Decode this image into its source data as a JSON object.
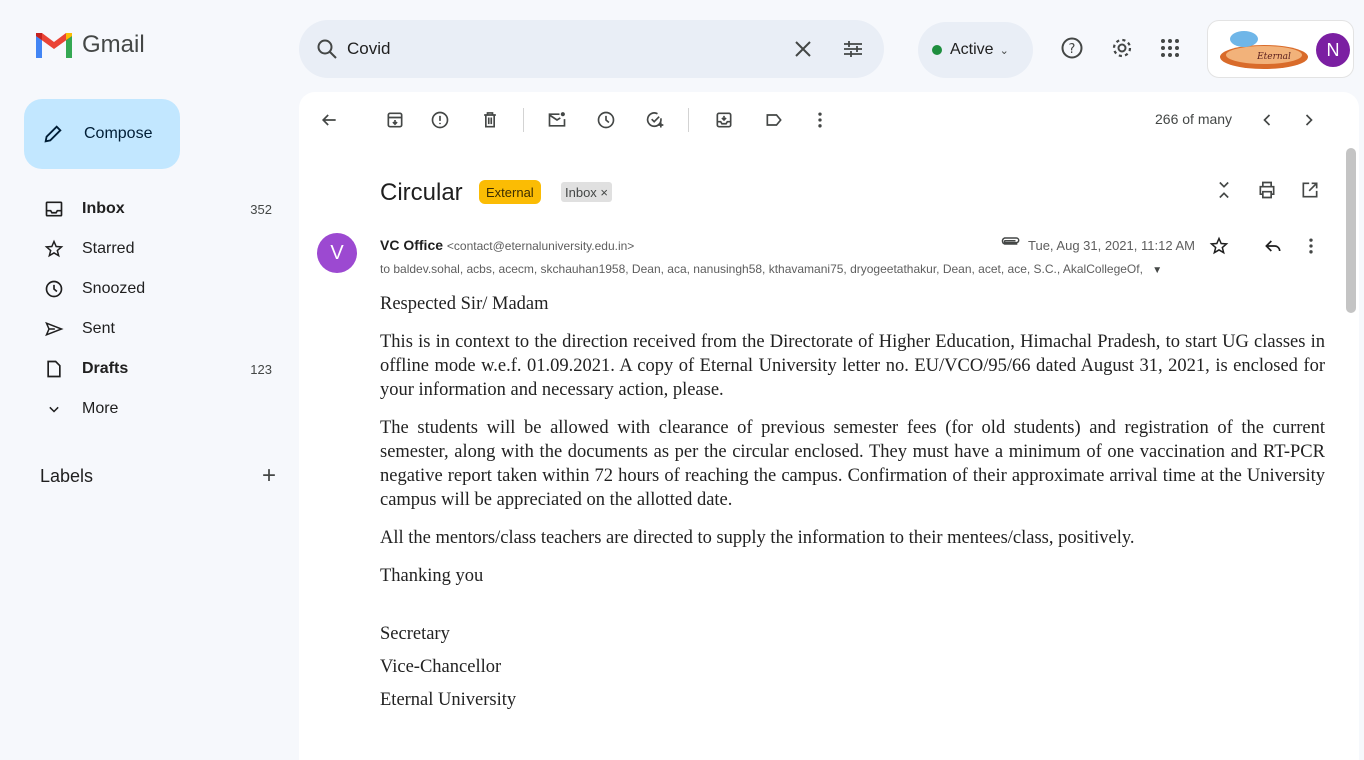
{
  "app": {
    "name": "Gmail"
  },
  "search": {
    "value": "Covid"
  },
  "status": {
    "label": "Active",
    "color": "#1e8e3e"
  },
  "account": {
    "initial": "N",
    "org_logo_text": "Eternal University"
  },
  "compose": {
    "label": "Compose"
  },
  "sidebar": {
    "items": [
      {
        "label": "Inbox",
        "count": "352",
        "icon": "inbox-icon",
        "bold": true
      },
      {
        "label": "Starred",
        "count": "",
        "icon": "star-icon",
        "bold": false
      },
      {
        "label": "Snoozed",
        "count": "",
        "icon": "clock-icon",
        "bold": false
      },
      {
        "label": "Sent",
        "count": "",
        "icon": "send-icon",
        "bold": false
      },
      {
        "label": "Drafts",
        "count": "123",
        "icon": "draft-icon",
        "bold": true
      },
      {
        "label": "More",
        "count": "",
        "icon": "chevron-down-icon",
        "bold": false
      }
    ],
    "labels_title": "Labels"
  },
  "toolbar": {
    "pager": "266 of many"
  },
  "email": {
    "subject": "Circular",
    "tags": {
      "external": "External",
      "inbox": "Inbox ×"
    },
    "sender_initial": "V",
    "sender_name": "VC Office",
    "sender_email": "<contact@eternaluniversity.edu.in>",
    "recipients": "to baldev.sohal, acbs, acecm, skchauhan1958, Dean, aca, nanusingh58, kthavamani75, dryogeetathakur, Dean, acet, ace, S.C., AkalCollegeOf,",
    "date": "Tue, Aug 31, 2021, 11:12 AM",
    "greeting": "Respected Sir/ Madam",
    "paragraphs": [
      "This is in context to the direction received from the Directorate of Higher Education, Himachal Pradesh, to start UG classes in offline mode w.e.f. 01.09.2021. A copy of Eternal University letter no. EU/VCO/95/66 dated August 31, 2021, is enclosed for your information and necessary action, please.",
      "The students will be allowed with clearance of previous semester fees (for old students) and registration of the current semester, along with the documents as per the circular enclosed. They must have a minimum of one vaccination and RT-PCR negative report taken within 72 hours of reaching the campus. Confirmation of their approximate arrival time at the University campus will be appreciated on the allotted date.",
      "All the mentors/class teachers are directed to supply the information to their mentees/class, positively."
    ],
    "closing": "Thanking you",
    "signature": [
      "Secretary",
      "Vice-Chancellor",
      "Eternal University"
    ]
  }
}
